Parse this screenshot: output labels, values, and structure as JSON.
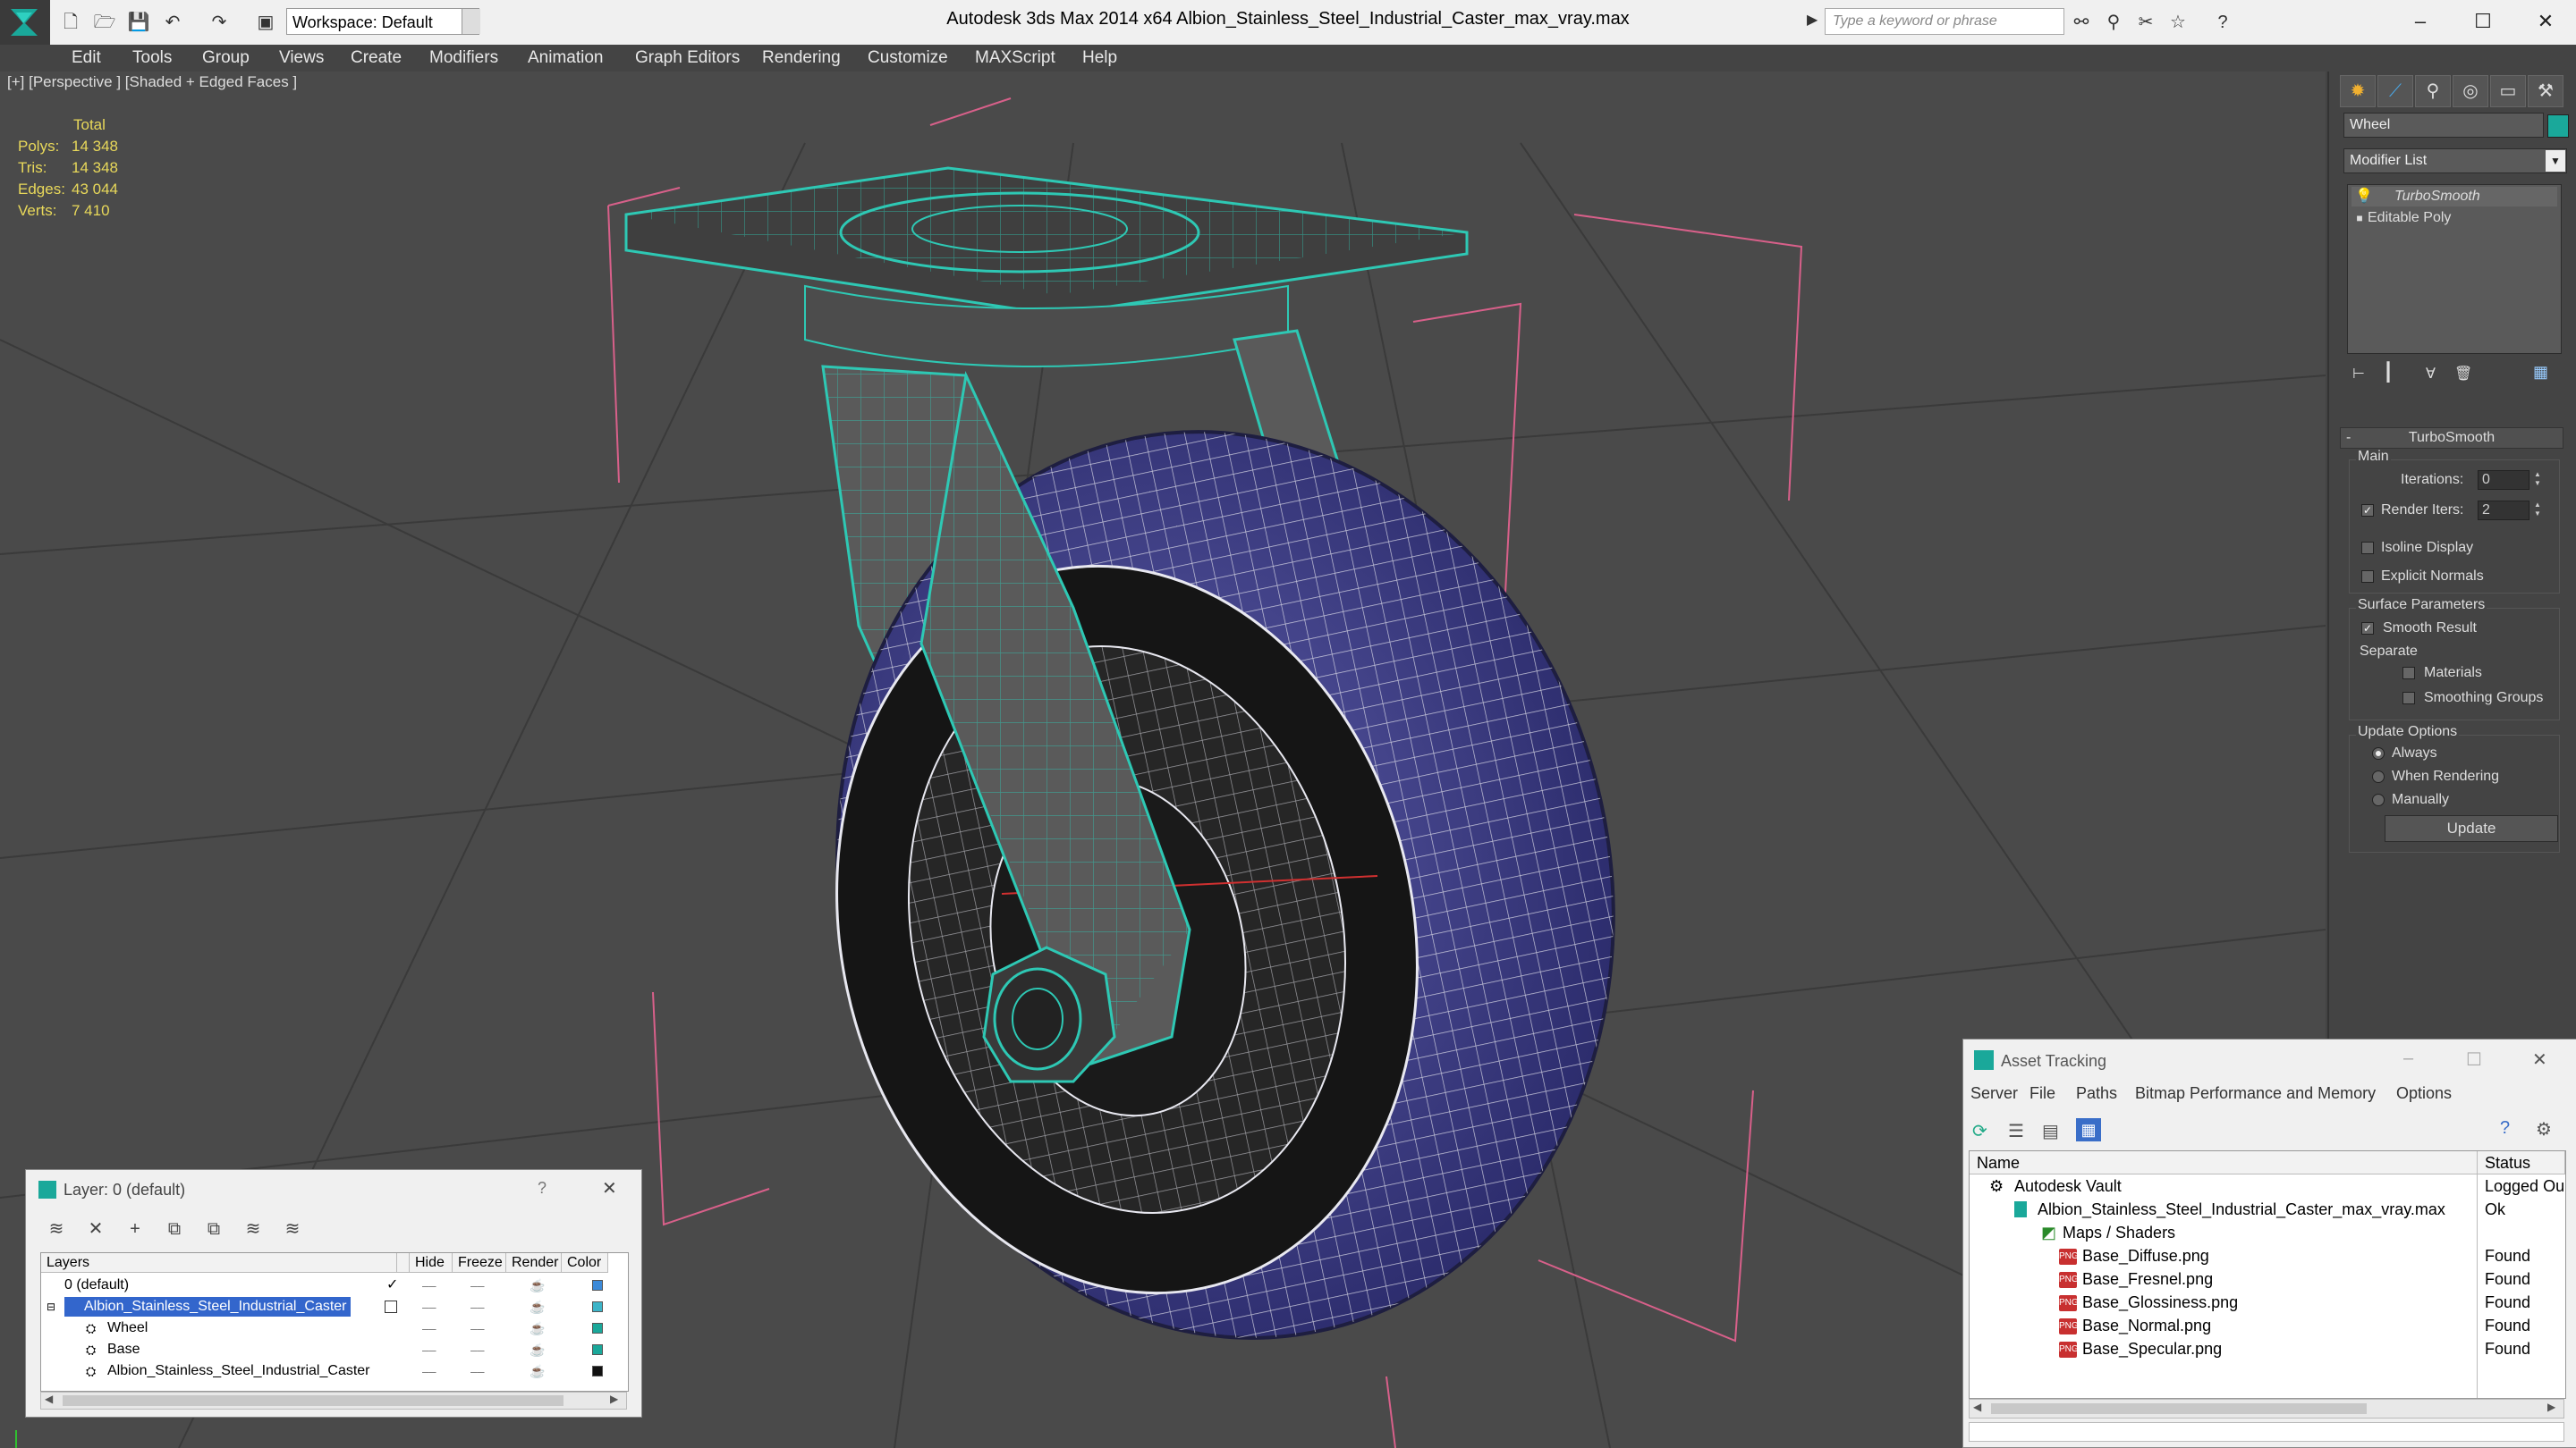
{
  "app": {
    "title": "Autodesk 3ds Max  2014 x64      Albion_Stainless_Steel_Industrial_Caster_max_vray.max",
    "workspace": "Workspace: Default",
    "search_placeholder": "Type a keyword or phrase",
    "window_controls": {
      "minimize": "–",
      "maximize": "☐",
      "close": "✕"
    }
  },
  "menu": [
    "Edit",
    "Tools",
    "Group",
    "Views",
    "Create",
    "Modifiers",
    "Animation",
    "Graph Editors",
    "Rendering",
    "Customize",
    "MAXScript",
    "Help"
  ],
  "viewport": {
    "label": "[+] [Perspective ] [Shaded + Edged Faces ]",
    "stats": {
      "header": "Total",
      "rows": [
        {
          "label": "Polys:",
          "value": "14 348"
        },
        {
          "label": "Tris:",
          "value": "14 348"
        },
        {
          "label": "Edges:",
          "value": "43 044"
        },
        {
          "label": "Verts:",
          "value": "7 410"
        }
      ]
    }
  },
  "command_panel": {
    "object_name": "Wheel",
    "object_color": "#1aa89a",
    "modifier_list": "Modifier List",
    "stack": [
      "TurboSmooth",
      "Editable Poly"
    ],
    "rollout": "TurboSmooth",
    "main_group": "Main",
    "iterations_label": "Iterations:",
    "iterations_value": "0",
    "render_iters_label": "Render Iters:",
    "render_iters_value": "2",
    "isoline": "Isoline Display",
    "explicit_normals": "Explicit Normals",
    "surface_group": "Surface Parameters",
    "smooth_result": "Smooth Result",
    "separate": "Separate",
    "materials": "Materials",
    "smoothing_groups": "Smoothing Groups",
    "update_group": "Update Options",
    "always": "Always",
    "when_rendering": "When Rendering",
    "manually": "Manually",
    "update_button": "Update"
  },
  "layer_dialog": {
    "title": "Layer: 0 (default)",
    "help": "?",
    "close": "✕",
    "columns": [
      "Layers",
      "Hide",
      "Freeze",
      "Render",
      "Color"
    ],
    "rows": [
      {
        "name": "0 (default)",
        "color": "#3c8ad8"
      },
      {
        "name": "Albion_Stainless_Steel_Industrial_Caster",
        "color": "#3cb4c8"
      },
      {
        "name": "Wheel",
        "color": "#1aa89a"
      },
      {
        "name": "Base",
        "color": "#1aa89a"
      },
      {
        "name": "Albion_Stainless_Steel_Industrial_Caster",
        "color": "#111111"
      }
    ]
  },
  "asset_dialog": {
    "title": "Asset Tracking",
    "menu": [
      "Server",
      "File",
      "Paths",
      "Bitmap Performance and Memory",
      "Options"
    ],
    "columns": [
      "Name",
      "Status"
    ],
    "rows": [
      {
        "name": "Autodesk Vault",
        "status": "Logged Ou"
      },
      {
        "name": "Albion_Stainless_Steel_Industrial_Caster_max_vray.max",
        "status": "Ok"
      },
      {
        "name": "Maps / Shaders",
        "status": ""
      },
      {
        "name": "Base_Diffuse.png",
        "status": "Found"
      },
      {
        "name": "Base_Fresnel.png",
        "status": "Found"
      },
      {
        "name": "Base_Glossiness.png",
        "status": "Found"
      },
      {
        "name": "Base_Normal.png",
        "status": "Found"
      },
      {
        "name": "Base_Specular.png",
        "status": "Found"
      }
    ]
  }
}
